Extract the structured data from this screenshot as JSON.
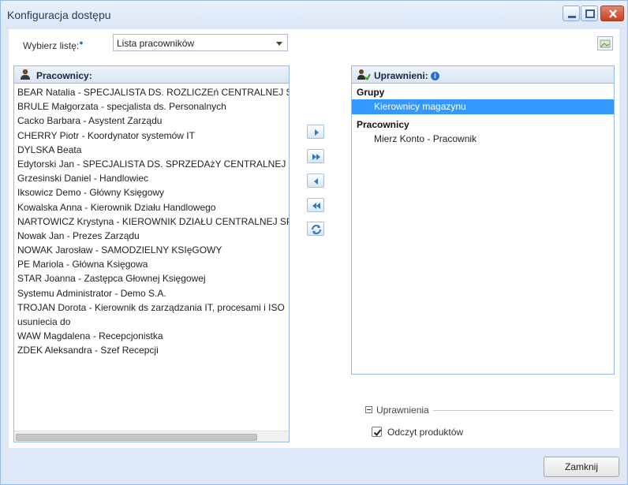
{
  "window": {
    "title": "Konfiguracja dostępu",
    "controls": {
      "minimize": "minimize-icon",
      "maximize": "maximize-icon",
      "close": "close-icon"
    }
  },
  "toolbar": {
    "list_label": "Wybierz listę:",
    "list_info_icon": "info-icon",
    "list_value": "Lista pracowników",
    "image_icon": "broken-image-icon"
  },
  "left_panel": {
    "title": "Pracownicy:",
    "icon": "user-icon",
    "items": [
      "BEAR Natalia - SPECJALISTA DS. ROZLICZEń CENTRALNEJ SPRZ",
      "BRULE Małgorzata - specjalista ds. Personalnych",
      "Cacko Barbara - Asystent Zarządu",
      "CHERRY Piotr - Koordynator systemów IT",
      "DYLSKA Beata",
      "Edytorski Jan - SPECJALISTA DS. SPRZEDAżY CENTRALNEJ",
      "Grzesinski Daniel - Handlowiec",
      "Iksowicz Demo - Główny Księgowy",
      "Kowalska Anna - Kierownik Działu Handlowego",
      "NARTOWICZ Krystyna - KIEROWNIK DZIAŁU CENTRALNEJ SPR",
      "Nowak Jan - Prezes Zarządu",
      "NOWAK Jarosław - SAMODZIELNY KSIęGOWY",
      "PE Mariola - Główna Księgowa",
      "STAR Joanna - Zastępca Głownej Księgowej",
      "Systemu Administrator - Demo S.A.",
      "TROJAN Dorota - Kierownik ds zarządzania IT, procesami i ISO",
      "usuniecia do",
      "WAW Magdalena - Recepcjonistka",
      "ZDEK Aleksandra - Szef Recepcji"
    ]
  },
  "move_buttons": {
    "add": "arrow-right-icon",
    "add_all": "double-arrow-right-icon",
    "remove": "arrow-left-icon",
    "remove_all": "double-arrow-left-icon",
    "refresh": "refresh-icon"
  },
  "right_panel": {
    "title": "Uprawnieni:",
    "icon": "users-permission-icon",
    "info_icon": "info-icon",
    "groups_title": "Grupy",
    "groups": [
      "Kierownicy magazynu"
    ],
    "employees_title": "Pracownicy",
    "employees": [
      "Mierz Konto - Pracownik"
    ]
  },
  "permissions": {
    "legend": "Uprawnienia",
    "checkbox_label": "Odczyt produktów",
    "checked": true
  },
  "footer": {
    "close_label": "Zamknij"
  },
  "colors": {
    "selection": "#3399ff",
    "border": "#99bbe8",
    "window_bg": "#dfe8f6"
  }
}
